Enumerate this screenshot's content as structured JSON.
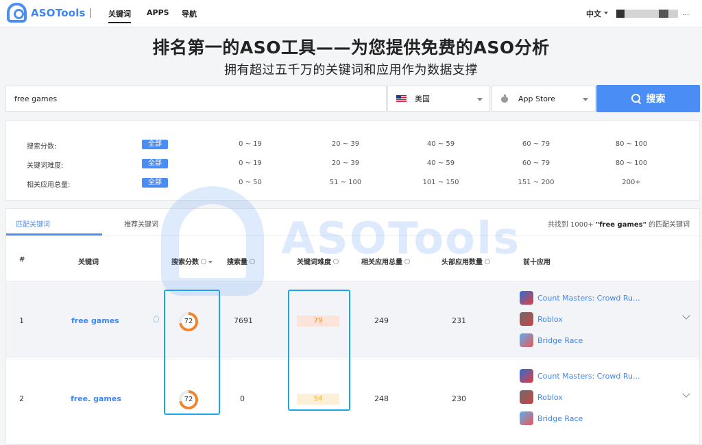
{
  "brand": {
    "name": "ASOTools"
  },
  "nav": {
    "items": [
      {
        "label": "关键词",
        "active": true
      },
      {
        "label": "APPS"
      },
      {
        "label": "导航"
      }
    ],
    "lang": "中文",
    "user_suffix": "..."
  },
  "hero": {
    "title": "排名第一的ASO工具——为您提供免费的ASO分析",
    "subtitle": "拥有超过五千万的关键词和应用作为数据支撑"
  },
  "search": {
    "value": "free games",
    "country": "美国",
    "store": "App Store",
    "button_label": "搜索"
  },
  "filters": [
    {
      "label": "搜索分数:",
      "all": "全部",
      "options": [
        "0 ~ 19",
        "20 ~ 39",
        "40 ~ 59",
        "60 ~ 79",
        "80 ~ 100"
      ]
    },
    {
      "label": "关键词难度:",
      "all": "全部",
      "options": [
        "0 ~ 19",
        "20 ~ 39",
        "40 ~ 59",
        "60 ~ 79",
        "80 ~ 100"
      ]
    },
    {
      "label": "相关应用总量:",
      "all": "全部",
      "options": [
        "0 ~ 50",
        "51 ~ 100",
        "101 ~ 150",
        "151 ~ 200",
        "200+"
      ]
    }
  ],
  "tabs": {
    "matched": "匹配关键词",
    "recommended": "推荐关键词",
    "found_prefix": "共找到 1000+ ",
    "found_query": "\"free games\"",
    "found_suffix": " 的匹配关键词"
  },
  "table": {
    "headers": {
      "index": "#",
      "keyword": "关键词",
      "score": "搜索分数",
      "volume": "搜索量",
      "difficulty": "关键词难度",
      "related": "相关应用总量",
      "top_apps": "头部应用数量",
      "top10": "前十应用"
    },
    "rows": [
      {
        "index": "1",
        "keyword": "free games",
        "score": "72",
        "score_pct": 72,
        "volume": "7691",
        "difficulty": "79",
        "related": "249",
        "top_apps": "231",
        "apps": [
          "Count Masters: Crowd Ru...",
          "Roblox",
          "Bridge Race"
        ]
      },
      {
        "index": "2",
        "keyword": "free. games",
        "score": "72",
        "score_pct": 72,
        "volume": "0",
        "difficulty": "54",
        "related": "248",
        "top_apps": "230",
        "apps": [
          "Count Masters: Crowd Ru...",
          "Roblox",
          "Bridge Race"
        ]
      }
    ]
  },
  "colors": {
    "accent": "#4a8ef5",
    "ring": "#f0842c",
    "difficulty_high_bg": "#fde4d8",
    "difficulty_high_fg": "#f0842c",
    "difficulty_mid_bg": "#fdf0d8",
    "difficulty_mid_fg": "#f0b12c",
    "highlight_box": "#16a9e8"
  }
}
